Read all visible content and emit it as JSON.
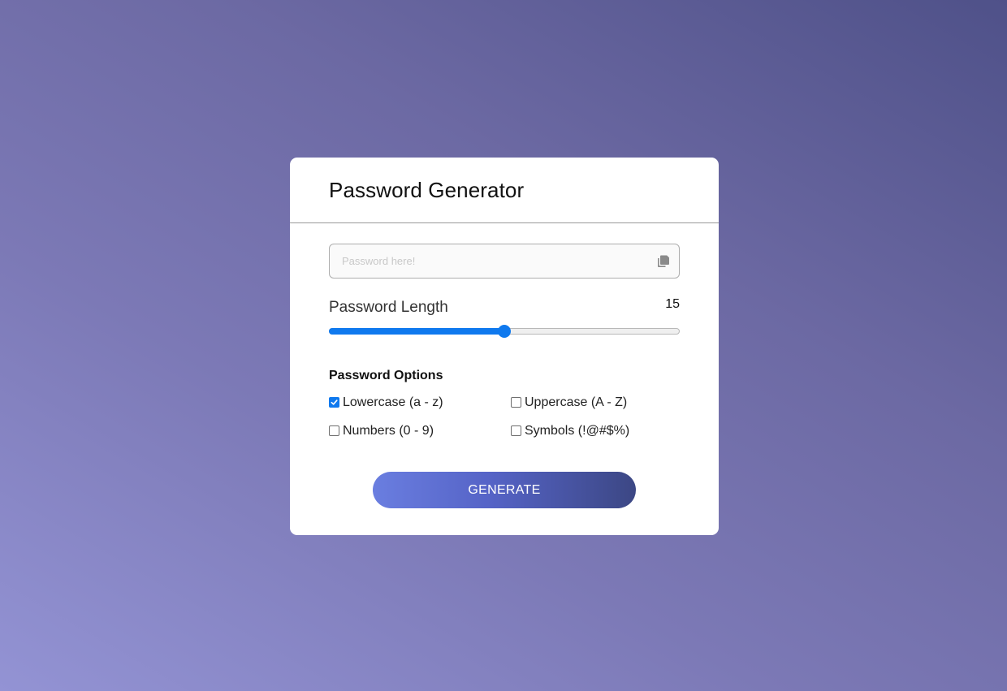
{
  "header": {
    "title": "Password Generator"
  },
  "password": {
    "value": "",
    "placeholder": "Password here!",
    "copy_icon": "copy-icon"
  },
  "length": {
    "label": "Password Length",
    "value": "15",
    "min": 0,
    "max": 30,
    "fill_fraction": 0.5
  },
  "options": {
    "title": "Password Options",
    "items": [
      {
        "label": "Lowercase (a - z)",
        "checked": true
      },
      {
        "label": "Uppercase (A - Z)",
        "checked": false
      },
      {
        "label": "Numbers (0 - 9)",
        "checked": false
      },
      {
        "label": "Symbols (!@#$%)",
        "checked": false
      }
    ]
  },
  "generate": {
    "label": "GENERATE"
  },
  "colors": {
    "accent": "#0f79ee",
    "button_start": "#6a7ee0",
    "button_end": "#3c4784"
  }
}
